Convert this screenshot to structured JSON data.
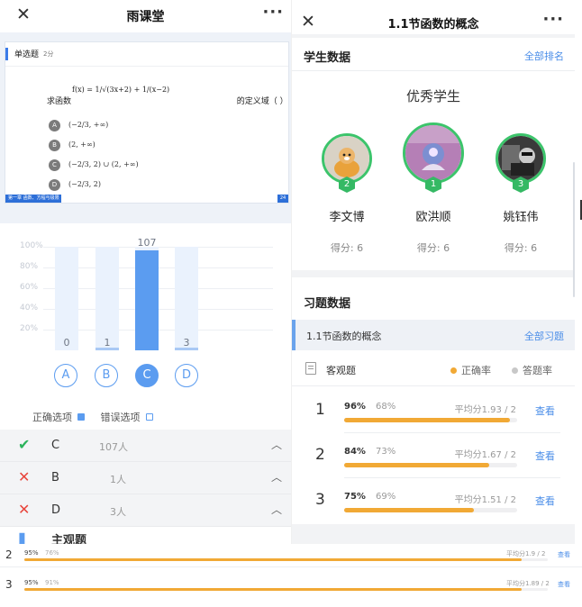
{
  "left": {
    "title": "雨课堂",
    "close_icon": "✕",
    "more_icon": "···",
    "slide": {
      "qtype": "单选题",
      "qscore": "2分",
      "stem_prefix": "求函数",
      "fx": "f(x) =",
      "frac_terms": "1/√(3x+2) + 1/(x−2)",
      "stem_suffix": "的定义域（      ）",
      "options": [
        {
          "letter": "A",
          "text": "(−2/3, +∞)"
        },
        {
          "letter": "B",
          "text": "(2, +∞)"
        },
        {
          "letter": "C",
          "text": "(−2/3, 2) ∪ (2, +∞)"
        },
        {
          "letter": "D",
          "text": "(−2/3, 2)"
        }
      ],
      "footer_left": "第一章 函数、方程与极限",
      "footer_right": "24"
    },
    "chart_data": {
      "type": "bar",
      "categories": [
        "A",
        "B",
        "C",
        "D"
      ],
      "values": [
        0,
        1,
        107,
        3
      ],
      "y_tick_labels": [
        "100%",
        "80%",
        "60%",
        "40%",
        "20%"
      ],
      "ylim": [
        0,
        100
      ],
      "selected": "C",
      "colors": {
        "bar": "#5b9cf0",
        "track": "#eaf2fd"
      }
    },
    "legend": {
      "correct": "正确选项",
      "wrong": "错误选项"
    },
    "answers": [
      {
        "icon": "check-icon",
        "symbol": "✔",
        "color": "#2bb35b",
        "option": "C",
        "count": "107人"
      },
      {
        "icon": "cross-icon",
        "symbol": "✕",
        "color": "#e8453c",
        "option": "B",
        "count": "1人"
      },
      {
        "icon": "cross-icon",
        "symbol": "✕",
        "color": "#e8453c",
        "option": "D",
        "count": "3人"
      }
    ],
    "partial_row": "主观题"
  },
  "right": {
    "title": "1.1节函数的概念",
    "close_icon": "✕",
    "more_icon": "···",
    "student_section": {
      "title": "学生数据",
      "link": "全部排名"
    },
    "top_students_title": "优秀学生",
    "students": [
      {
        "rank": "2",
        "name": "李文博",
        "score": "得分: 6"
      },
      {
        "rank": "1",
        "name": "欧洪顺",
        "score": "得分: 6"
      },
      {
        "rank": "3",
        "name": "姚钰伟",
        "score": "得分: 6"
      }
    ],
    "exercise_section": {
      "title": "习题数据"
    },
    "chapter": {
      "title": "1.1节函数的概念",
      "link": "全部习题"
    },
    "qtype_header": {
      "label": "客观题",
      "legend_correct": "正确率",
      "legend_answer": "答题率",
      "color_correct": "#f1a935",
      "color_answer": "#c8c8c8"
    },
    "questions": [
      {
        "num": "1",
        "correct": "96%",
        "answer": "68%",
        "avg": "平均分1.93 / 2",
        "view": "查看",
        "correct_rate": 0.96
      },
      {
        "num": "2",
        "correct": "84%",
        "answer": "73%",
        "avg": "平均分1.67 / 2",
        "view": "查看",
        "correct_rate": 0.84
      },
      {
        "num": "3",
        "correct": "75%",
        "answer": "69%",
        "avg": "平均分1.51 / 2",
        "view": "查看",
        "correct_rate": 0.75
      }
    ]
  },
  "bottom": [
    {
      "num": "2",
      "correct": "95%",
      "answer": "76%",
      "avg": "平均分1.9 / 2",
      "view": "查看",
      "correct_rate": 0.95
    },
    {
      "num": "3",
      "correct": "95%",
      "answer": "91%",
      "avg": "平均分1.89 / 2",
      "view": "查看",
      "correct_rate": 0.95
    }
  ]
}
